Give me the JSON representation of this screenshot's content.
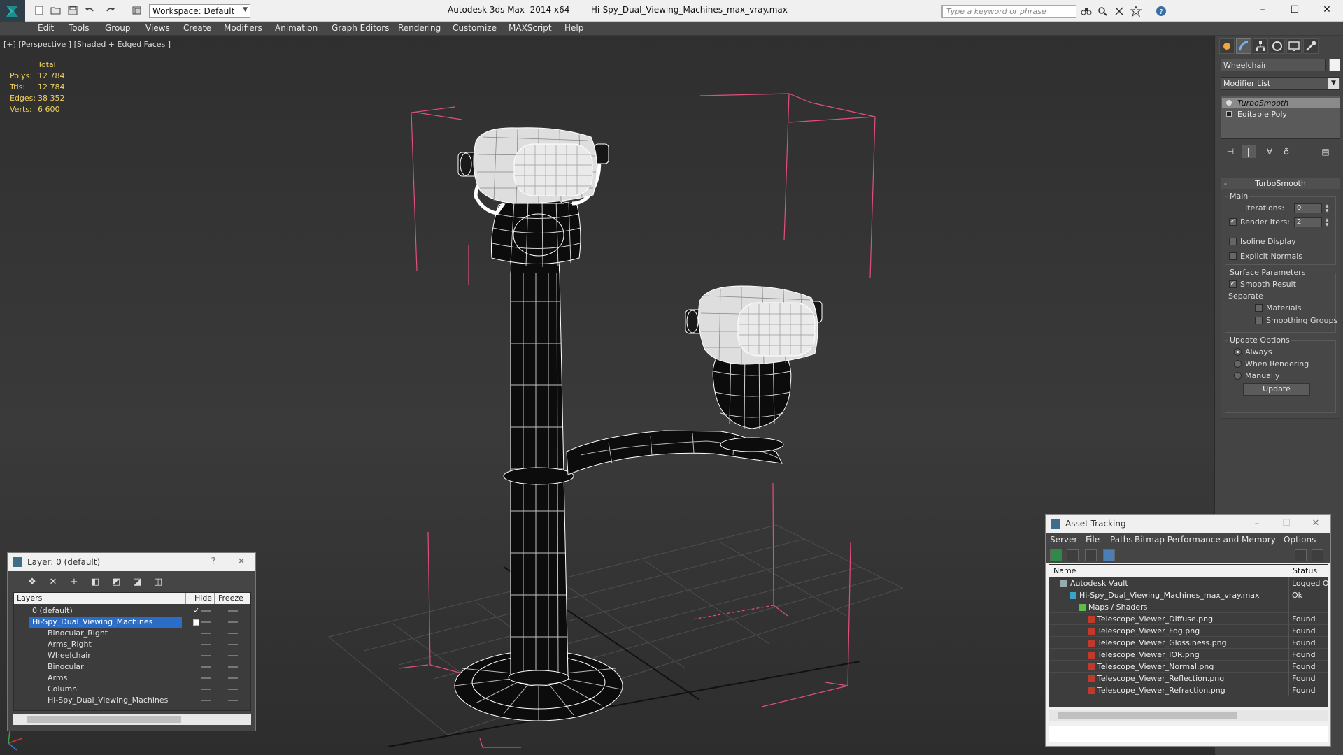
{
  "titlebar": {
    "workspace": "Workspace: Default",
    "app_title": "Autodesk 3ds Max  2014 x64",
    "file_title": "Hi-Spy_Dual_Viewing_Machines_max_vray.max",
    "search_placeholder": "Type a keyword or phrase"
  },
  "menu": [
    "Edit",
    "Tools",
    "Group",
    "Views",
    "Create",
    "Modifiers",
    "Animation",
    "Graph Editors",
    "Rendering",
    "Customize",
    "MAXScript",
    "Help"
  ],
  "viewport": {
    "label": "[+] [Perspective ] [Shaded + Edged Faces ]",
    "stats_header": "Total",
    "stats": [
      {
        "label": "Polys:",
        "value": "12 784"
      },
      {
        "label": "Tris:",
        "value": "12 784"
      },
      {
        "label": "Edges:",
        "value": "38 352"
      },
      {
        "label": "Verts:",
        "value": "6 600"
      }
    ]
  },
  "command_panel": {
    "object_name": "Wheelchair",
    "modifier_list": "Modifier List",
    "stack": [
      "TurboSmooth",
      "Editable Poly"
    ],
    "rollout_title": "TurboSmooth",
    "main_group": "Main",
    "iterations_label": "Iterations:",
    "iterations_value": "0",
    "render_iters_label": "Render Iters:",
    "render_iters_value": "2",
    "render_iters_checked": true,
    "isoline_label": "Isoline Display",
    "explicit_normals_label": "Explicit Normals",
    "surface_params": "Surface Parameters",
    "smooth_result_label": "Smooth Result",
    "separate_label": "Separate",
    "materials_label": "Materials",
    "smoothing_groups_label": "Smoothing Groups",
    "update_options": "Update Options",
    "always_label": "Always",
    "when_rendering_label": "When Rendering",
    "manually_label": "Manually",
    "update_button": "Update"
  },
  "layer_dialog": {
    "title": "Layer: 0 (default)",
    "help": "?",
    "col_layers": "Layers",
    "col_hide": "Hide",
    "col_freeze": "Freeze",
    "rows": [
      {
        "name": "0 (default)",
        "indent": 0,
        "selected": false,
        "current": true
      },
      {
        "name": "Hi-Spy_Dual_Viewing_Machines",
        "indent": 0,
        "selected": true,
        "current": false
      },
      {
        "name": "Binocular_Right",
        "indent": 1,
        "selected": false,
        "current": false
      },
      {
        "name": "Arms_Right",
        "indent": 1,
        "selected": false,
        "current": false
      },
      {
        "name": "Wheelchair",
        "indent": 1,
        "selected": false,
        "current": false
      },
      {
        "name": "Binocular",
        "indent": 1,
        "selected": false,
        "current": false
      },
      {
        "name": "Arms",
        "indent": 1,
        "selected": false,
        "current": false
      },
      {
        "name": "Column",
        "indent": 1,
        "selected": false,
        "current": false
      },
      {
        "name": "Hi-Spy_Dual_Viewing_Machines",
        "indent": 1,
        "selected": false,
        "current": false
      }
    ]
  },
  "asset_dialog": {
    "title": "Asset Tracking",
    "menu": [
      "Server",
      "File",
      "Paths",
      "Bitmap Performance and Memory",
      "Options"
    ],
    "col_name": "Name",
    "col_status": "Status",
    "rows": [
      {
        "name": "Autodesk Vault",
        "status": "Logged O",
        "indent": 0,
        "icon": "vault-icon"
      },
      {
        "name": "Hi-Spy_Dual_Viewing_Machines_max_vray.max",
        "status": "Ok",
        "indent": 1,
        "icon": "max-file-icon"
      },
      {
        "name": "Maps / Shaders",
        "status": "",
        "indent": 2,
        "icon": "maps-icon"
      },
      {
        "name": "Telescope_Viewer_Diffuse.png",
        "status": "Found",
        "indent": 3,
        "icon": "png-icon"
      },
      {
        "name": "Telescope_Viewer_Fog.png",
        "status": "Found",
        "indent": 3,
        "icon": "png-icon"
      },
      {
        "name": "Telescope_Viewer_Glossiness.png",
        "status": "Found",
        "indent": 3,
        "icon": "png-icon"
      },
      {
        "name": "Telescope_Viewer_IOR.png",
        "status": "Found",
        "indent": 3,
        "icon": "png-icon"
      },
      {
        "name": "Telescope_Viewer_Normal.png",
        "status": "Found",
        "indent": 3,
        "icon": "png-icon"
      },
      {
        "name": "Telescope_Viewer_Reflection.png",
        "status": "Found",
        "indent": 3,
        "icon": "png-icon"
      },
      {
        "name": "Telescope_Viewer_Refraction.png",
        "status": "Found",
        "indent": 3,
        "icon": "png-icon"
      }
    ]
  },
  "colors": {
    "stats_text": "#f0d060",
    "selection": "#2a6cc6",
    "wire": "#ffffff",
    "bbox": "#e0507a"
  }
}
